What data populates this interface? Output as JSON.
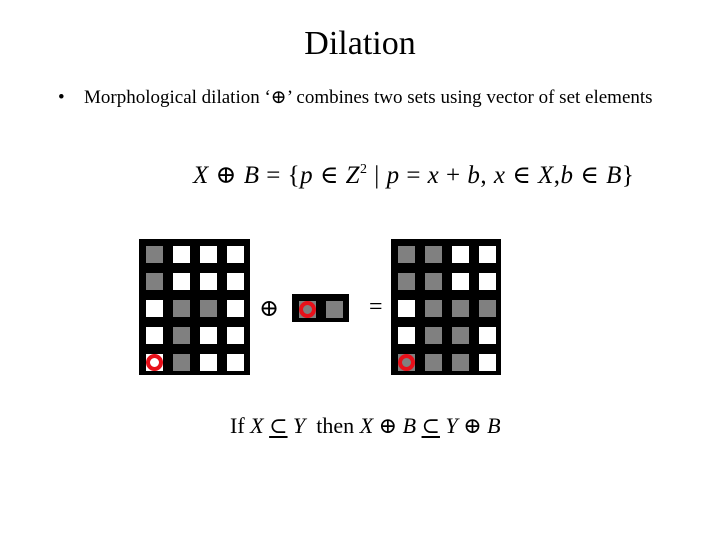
{
  "title": "Dilation",
  "bullet": {
    "symbol": "•",
    "text": "Morphological dilation ‘⊕’ combines two sets using vector of set elements"
  },
  "formula": {
    "lhs_X": "X",
    "op": "⊕",
    "lhs_B": "B",
    "eq_open": "= {",
    "p1": "p",
    "in1": "∈",
    "Z": "Z",
    "exp": "2",
    "bar": "|",
    "p2": "p",
    "eq2": "=",
    "x1": "x",
    "plus": "+",
    "b1": "b",
    "comma1": ",",
    "x2": "x",
    "in2": "∈",
    "X2": "X",
    "comma2": ",",
    "b2": "b",
    "in3": "∈",
    "B2": "B",
    "close": "}"
  },
  "diagram": {
    "colors": {
      "background": "#000000",
      "white": "#ffffff",
      "gray": "#808080",
      "origin_ring": "#e8101a"
    },
    "set_X": {
      "rows": [
        [
          "g",
          "w",
          "w",
          "w"
        ],
        [
          "g",
          "w",
          "w",
          "w"
        ],
        [
          "w",
          "g",
          "g",
          "w"
        ],
        [
          "w",
          "g",
          "w",
          "w"
        ],
        [
          "ow",
          "g",
          "w",
          "w"
        ]
      ]
    },
    "dilate_symbol": "⊕",
    "set_B": {
      "rows": [
        [
          "o",
          "g"
        ]
      ]
    },
    "equals_symbol": "=",
    "result": {
      "rows": [
        [
          "g",
          "g",
          "w",
          "w"
        ],
        [
          "g",
          "g",
          "w",
          "w"
        ],
        [
          "w",
          "g",
          "g",
          "g"
        ],
        [
          "w",
          "g",
          "g",
          "w"
        ],
        [
          "o",
          "g",
          "g",
          "w"
        ]
      ]
    }
  },
  "property": {
    "if": "If",
    "X1": "X",
    "subset1": "⊂",
    "Y1": "Y",
    "then": "then",
    "X2": "X",
    "op1": "⊕",
    "B1": "B",
    "subset2": "⊂",
    "Y2": "Y",
    "op2": "⊕",
    "B2": "B"
  }
}
